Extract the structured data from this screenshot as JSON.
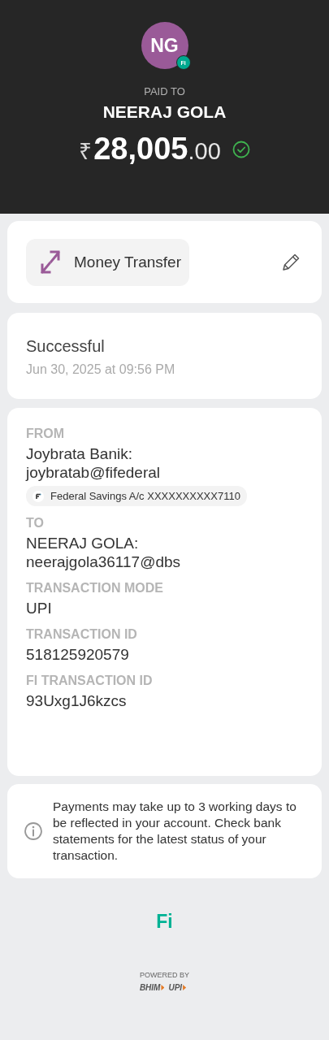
{
  "header": {
    "avatar_initials": "NG",
    "avatar_badge": "Fi",
    "paid_to_label": "PAID TO",
    "payee_name": "NEERAJ GOLA",
    "amount": {
      "currency": "₹",
      "whole": "28,005",
      "fraction": ".00"
    },
    "verified": true
  },
  "category": {
    "label": "Money Transfer"
  },
  "status": {
    "title": "Successful",
    "timestamp": "Jun 30, 2025 at 09:56 PM"
  },
  "details": [
    {
      "label": "FROM",
      "value": "Joybrata Banik:\njoybratab@fifederal",
      "account": "Federal Savings A/c XXXXXXXXXX7110"
    },
    {
      "label": "TO",
      "value": "NEERAJ GOLA:\nneerajgola36117@dbs"
    },
    {
      "label": "TRANSACTION MODE",
      "value": "UPI"
    },
    {
      "label": "TRANSACTION ID",
      "value": "518125920579"
    },
    {
      "label": "FI TRANSACTION ID",
      "value": "93Uxg1J6kzcs"
    }
  ],
  "notice": "Payments may take up to 3 working days to be reflected in your account. Check bank statements for the latest status of your transaction.",
  "footer": {
    "logo": "Fi",
    "powered_by": "POWERED BY",
    "bhim": "BHIM",
    "upi": "UPI"
  }
}
